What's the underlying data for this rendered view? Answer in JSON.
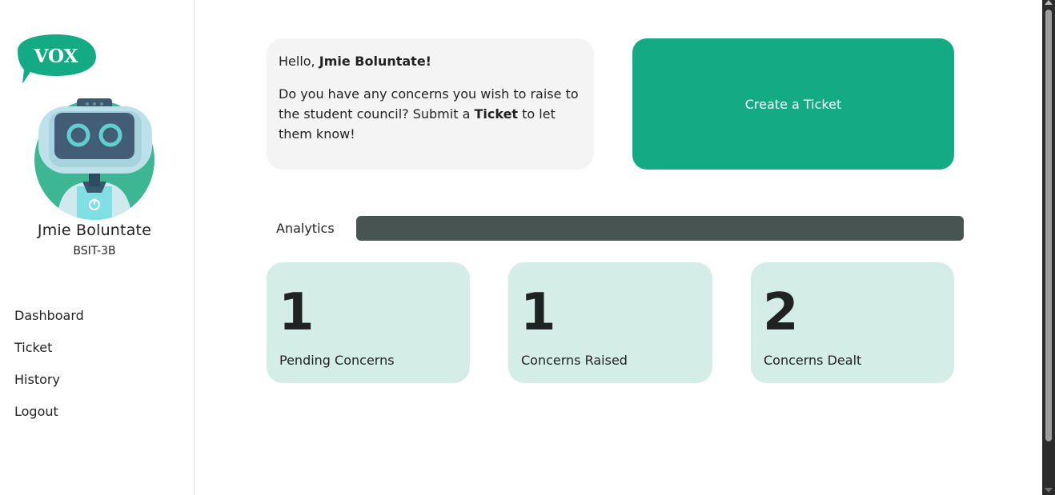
{
  "app": {
    "logo_text": "VOX",
    "accent_color": "#14aa84"
  },
  "user": {
    "name": "Jmie Boluntate",
    "section": "BSIT-3B"
  },
  "sidebar": {
    "items": [
      {
        "label": "Dashboard"
      },
      {
        "label": "Ticket"
      },
      {
        "label": "History"
      },
      {
        "label": "Logout"
      }
    ]
  },
  "greeting": {
    "hello_prefix": "Hello, ",
    "name": "Jmie Boluntate!",
    "message_part1": "Do you have any concerns you wish to raise to the student council? Submit a ",
    "message_bold": "Ticket",
    "message_part2": " to let them know!"
  },
  "actions": {
    "create_ticket_label": "Create a Ticket"
  },
  "analytics": {
    "label": "Analytics",
    "stats": [
      {
        "value": "1",
        "label": "Pending Concerns"
      },
      {
        "value": "1",
        "label": "Concerns Raised"
      },
      {
        "value": "2",
        "label": "Concerns Dealt"
      }
    ]
  }
}
